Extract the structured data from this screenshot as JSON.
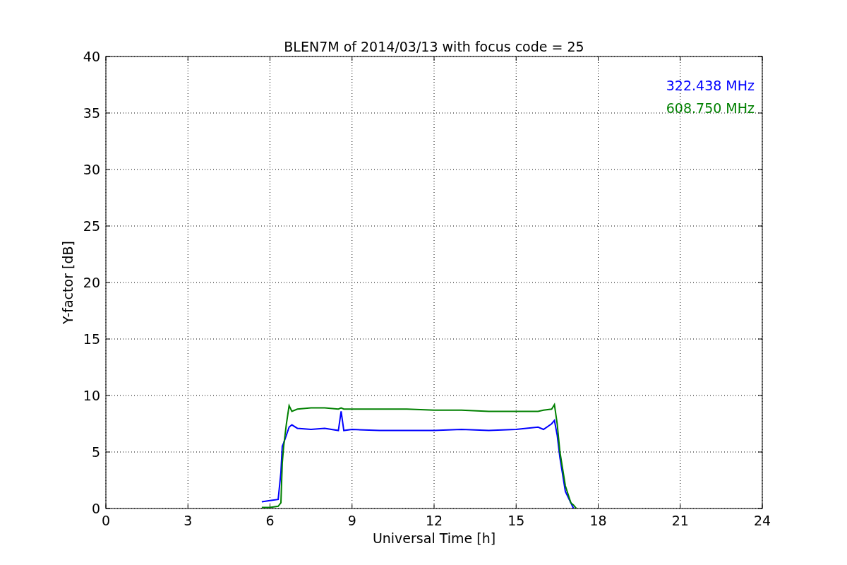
{
  "chart_data": {
    "type": "line",
    "title": "BLEN7M of 2014/03/13 with focus code = 25",
    "xlabel": "Universal Time [h]",
    "ylabel": "Y-factor [dB]",
    "x": [
      5.7,
      6.0,
      6.3,
      6.4,
      6.45,
      6.5,
      6.6,
      6.7,
      6.8,
      7,
      7.5,
      8,
      8.5,
      8.6,
      8.7,
      9,
      10,
      11,
      12,
      13,
      14,
      15,
      15.8,
      16,
      16.3,
      16.4,
      16.5,
      16.6,
      16.8,
      17,
      17.1,
      17.2
    ],
    "series": [
      {
        "name": "322.438 MHz",
        "color": "#0000ff",
        "values": [
          0.6,
          0.7,
          0.8,
          3.2,
          5.5,
          5.8,
          6.5,
          7.2,
          7.4,
          7.1,
          7.0,
          7.1,
          6.9,
          8.6,
          6.9,
          7.0,
          6.9,
          6.9,
          6.9,
          7.0,
          6.9,
          7.0,
          7.2,
          7.0,
          7.5,
          7.8,
          6.5,
          4.5,
          1.5,
          0.5,
          0,
          null
        ]
      },
      {
        "name": "608.750 MHz",
        "color": "#008000",
        "values": [
          0.1,
          0.1,
          0.2,
          0.5,
          4.0,
          5.5,
          7.5,
          9.1,
          8.6,
          8.8,
          8.9,
          8.9,
          8.8,
          8.9,
          8.8,
          8.8,
          8.8,
          8.8,
          8.7,
          8.7,
          8.6,
          8.6,
          8.6,
          8.7,
          8.8,
          9.2,
          7.5,
          5.0,
          2.0,
          0.5,
          0.3,
          0
        ]
      }
    ],
    "grid": true,
    "xlim": [
      0,
      24
    ],
    "ylim": [
      0,
      40
    ],
    "xticks": [
      0,
      3,
      6,
      9,
      12,
      15,
      18,
      21,
      24
    ],
    "yticks": [
      0,
      5,
      10,
      15,
      20,
      25,
      30,
      35,
      40
    ]
  }
}
